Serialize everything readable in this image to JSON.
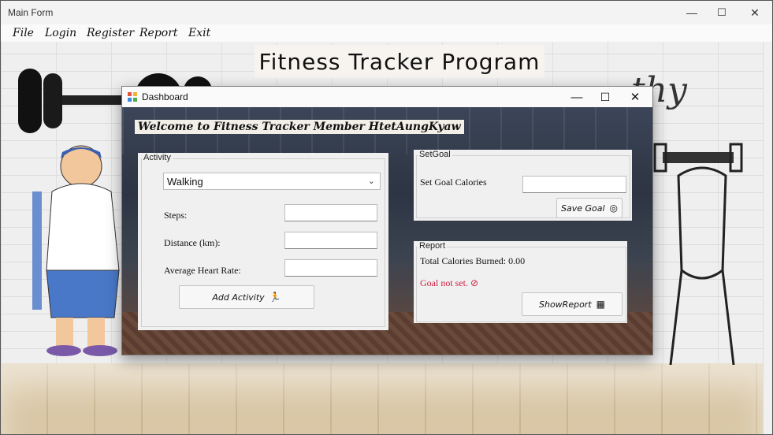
{
  "main_window": {
    "title": "Main Form",
    "controls": {
      "minimize": "—",
      "maximize": "☐",
      "close": "✕"
    }
  },
  "menu": [
    {
      "label": "File"
    },
    {
      "label": "Login"
    },
    {
      "label": "Register"
    },
    {
      "label": "Report"
    },
    {
      "label": "Exit"
    }
  ],
  "banner": {
    "text": "Fitness Tracker Program"
  },
  "background_graffiti": "thy",
  "dashboard": {
    "title": "Dashboard",
    "controls": {
      "minimize": "—",
      "maximize": "☐",
      "close": "✕"
    },
    "welcome": "Welcome to Fitness Tracker Member HtetAungKyaw",
    "activity": {
      "group_label": "Activity",
      "activity_type": "Walking",
      "steps_label": "Steps:",
      "steps_value": "",
      "distance_label": "Distance (km):",
      "distance_value": "",
      "heart_rate_label": "Average Heart Rate:",
      "heart_rate_value": "",
      "add_button": "Add Activity",
      "add_icon": "runner-icon"
    },
    "set_goal": {
      "group_label": "SetGoal",
      "calories_label": "Set Goal Calories",
      "calories_value": "",
      "save_button": "Save Goal",
      "save_icon": "target-icon"
    },
    "report": {
      "group_label": "Report",
      "total_calories": "Total Calories Burned: 0.00",
      "goal_status": "Goal not set.",
      "goal_status_icon": "⊘",
      "show_button": "ShowReport",
      "show_icon": "chart-icon"
    }
  },
  "colors": {
    "goal_status": "#d02040",
    "dash_accent": "#2b3240"
  }
}
